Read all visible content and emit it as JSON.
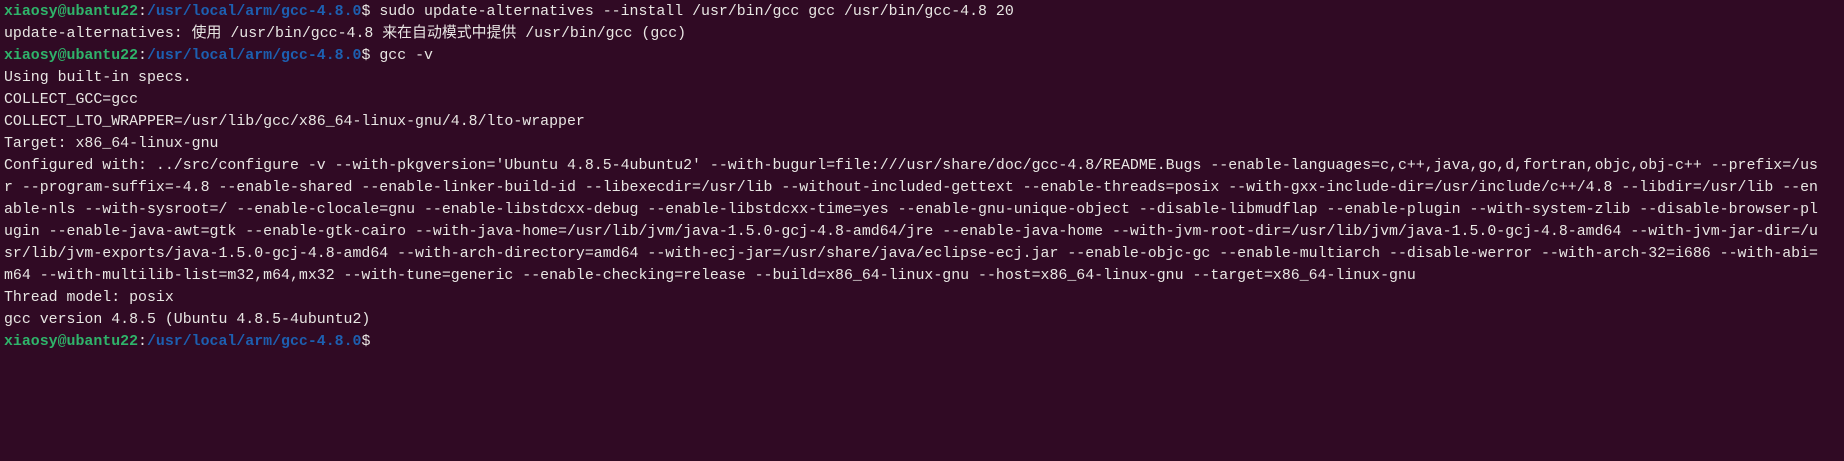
{
  "prompt": {
    "user_host": "xiaosy@ubantu22",
    "sep": ":",
    "path": "/usr/local/arm/gcc-4.8.0",
    "symbol": "$ "
  },
  "colors": {
    "background": "#300a24",
    "user_host": "#2fb36a",
    "path": "#1d5fb0",
    "text": "#e8e6e3"
  },
  "commands": [
    "sudo update-alternatives --install /usr/bin/gcc gcc /usr/bin/gcc-4.8 20",
    "gcc -v",
    ""
  ],
  "output1": [
    "update-alternatives: 使用 /usr/bin/gcc-4.8 来在自动模式中提供 /usr/bin/gcc (gcc)"
  ],
  "output2": [
    "Using built-in specs.",
    "COLLECT_GCC=gcc",
    "COLLECT_LTO_WRAPPER=/usr/lib/gcc/x86_64-linux-gnu/4.8/lto-wrapper",
    "Target: x86_64-linux-gnu",
    "Configured with: ../src/configure -v --with-pkgversion='Ubuntu 4.8.5-4ubuntu2' --with-bugurl=file:///usr/share/doc/gcc-4.8/README.Bugs --enable-languages=c,c++,java,go,d,fortran,objc,obj-c++ --prefix=/us",
    "r --program-suffix=-4.8 --enable-shared --enable-linker-build-id --libexecdir=/usr/lib --without-included-gettext --enable-threads=posix --with-gxx-include-dir=/usr/include/c++/4.8 --libdir=/usr/lib --en",
    "able-nls --with-sysroot=/ --enable-clocale=gnu --enable-libstdcxx-debug --enable-libstdcxx-time=yes --enable-gnu-unique-object --disable-libmudflap --enable-plugin --with-system-zlib --disable-browser-pl",
    "ugin --enable-java-awt=gtk --enable-gtk-cairo --with-java-home=/usr/lib/jvm/java-1.5.0-gcj-4.8-amd64/jre --enable-java-home --with-jvm-root-dir=/usr/lib/jvm/java-1.5.0-gcj-4.8-amd64 --with-jvm-jar-dir=/u",
    "sr/lib/jvm-exports/java-1.5.0-gcj-4.8-amd64 --with-arch-directory=amd64 --with-ecj-jar=/usr/share/java/eclipse-ecj.jar --enable-objc-gc --enable-multiarch --disable-werror --with-arch-32=i686 --with-abi=",
    "m64 --with-multilib-list=m32,m64,mx32 --with-tune=generic --enable-checking=release --build=x86_64-linux-gnu --host=x86_64-linux-gnu --target=x86_64-linux-gnu",
    "Thread model: posix",
    "gcc version 4.8.5 (Ubuntu 4.8.5-4ubuntu2)"
  ]
}
